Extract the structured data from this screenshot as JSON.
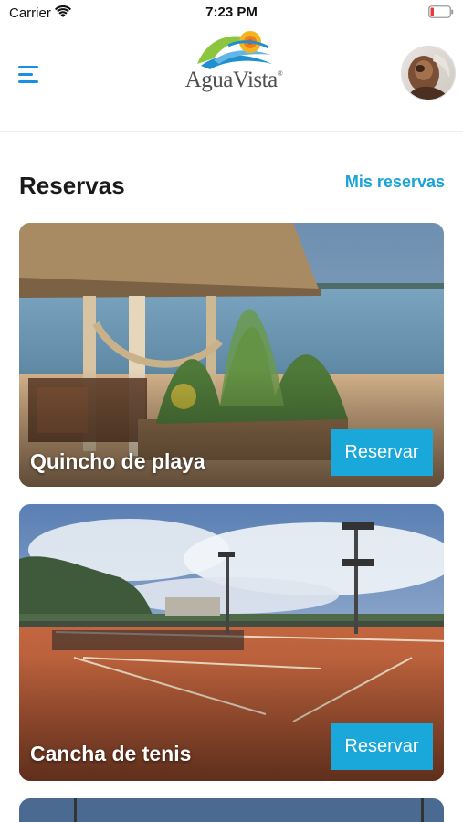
{
  "status_bar": {
    "carrier": "Carrier",
    "time": "7:23 PM",
    "wifi_icon": "wifi-icon",
    "battery_icon": "battery-low-icon",
    "battery_color": "#e23b3b"
  },
  "header": {
    "menu_icon": "hamburger-menu-icon",
    "logo_text": "AguaVista",
    "logo_mark": "®",
    "avatar_icon": "user-avatar"
  },
  "section": {
    "title": "Reservas",
    "my_bookings_link": "Mis reservas"
  },
  "facilities": [
    {
      "name": "Quincho de playa",
      "action": "Reservar"
    },
    {
      "name": "Cancha de tenis",
      "action": "Reservar"
    }
  ],
  "colors": {
    "accent": "#1aa8db",
    "menu": "#1d8fe1",
    "link": "#1aa3d6"
  }
}
